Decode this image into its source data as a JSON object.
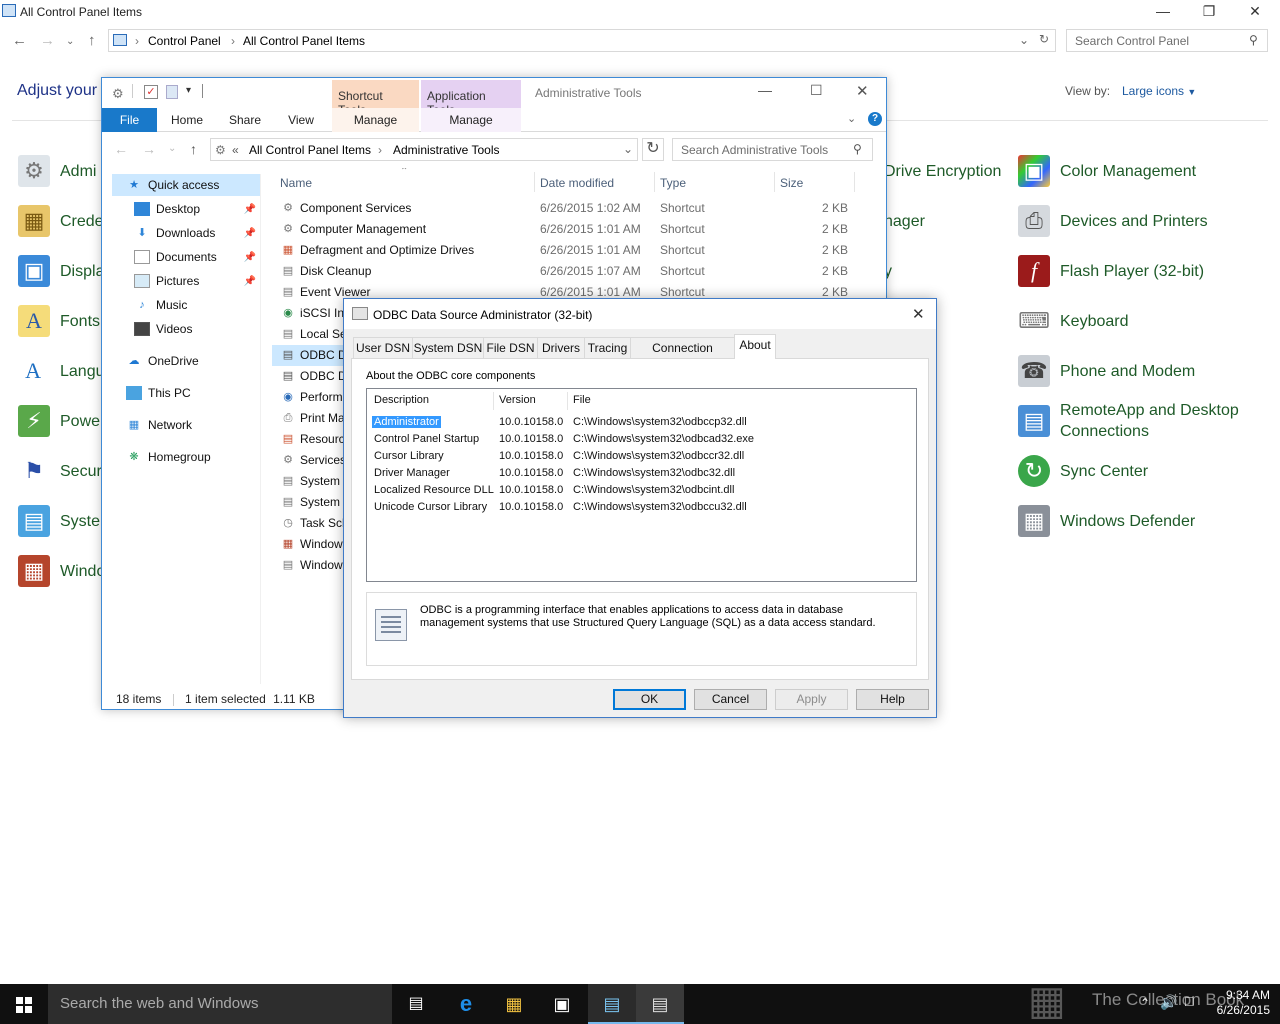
{
  "control_panel": {
    "window_title": "All Control Panel Items",
    "breadcrumb": [
      "Control Panel",
      "All Control Panel Items"
    ],
    "search_placeholder": "Search Control Panel",
    "heading": "Adjust your",
    "view_by_label": "View by:",
    "view_by_value": "Large icons",
    "left_items": [
      "Admi",
      "Crede",
      "Displa",
      "Fonts",
      "Langu",
      "Power",
      "Secur",
      "Syster",
      "Windo"
    ],
    "middle_items": [
      "Drive Encryption",
      "nager",
      "y"
    ],
    "right_items": [
      "Color Management",
      "Devices and Printers",
      "Flash Player (32-bit)",
      "Keyboard",
      "Phone and Modem",
      "RemoteApp and Desktop Connections",
      "Sync Center",
      "Windows Defender"
    ]
  },
  "explorer": {
    "title": "Administrative Tools",
    "context_tabs": {
      "shortcut_tools": "Shortcut Tools",
      "application_tools": "Application Tools"
    },
    "ribbon_tabs": [
      "File",
      "Home",
      "Share",
      "View",
      "Manage",
      "Manage"
    ],
    "breadcrumb_prefix": "«",
    "breadcrumb": [
      "All Control Panel Items",
      "Administrative Tools"
    ],
    "search_placeholder": "Search Administrative Tools",
    "nav_pane": [
      "Quick access",
      "Desktop",
      "Downloads",
      "Documents",
      "Pictures",
      "Music",
      "Videos",
      "OneDrive",
      "This PC",
      "Network",
      "Homegroup"
    ],
    "columns": [
      "Name",
      "Date modified",
      "Type",
      "Size"
    ],
    "files": [
      {
        "name": "Component Services",
        "date": "6/26/2015 1:02 AM",
        "type": "Shortcut",
        "size": "2 KB"
      },
      {
        "name": "Computer Management",
        "date": "6/26/2015 1:01 AM",
        "type": "Shortcut",
        "size": "2 KB"
      },
      {
        "name": "Defragment and Optimize Drives",
        "date": "6/26/2015 1:01 AM",
        "type": "Shortcut",
        "size": "2 KB"
      },
      {
        "name": "Disk Cleanup",
        "date": "6/26/2015 1:07 AM",
        "type": "Shortcut",
        "size": "2 KB"
      },
      {
        "name": "Event Viewer",
        "date": "6/26/2015 1:01 AM",
        "type": "Shortcut",
        "size": "2 KB"
      },
      {
        "name": "iSCSI Ini",
        "date": "",
        "type": "",
        "size": ""
      },
      {
        "name": "Local Se",
        "date": "",
        "type": "",
        "size": ""
      },
      {
        "name": "ODBC D",
        "date": "",
        "type": "",
        "size": ""
      },
      {
        "name": "ODBC D",
        "date": "",
        "type": "",
        "size": ""
      },
      {
        "name": "Perform",
        "date": "",
        "type": "",
        "size": ""
      },
      {
        "name": "Print Ma",
        "date": "",
        "type": "",
        "size": ""
      },
      {
        "name": "Resourc",
        "date": "",
        "type": "",
        "size": ""
      },
      {
        "name": "Services",
        "date": "",
        "type": "",
        "size": ""
      },
      {
        "name": "System C",
        "date": "",
        "type": "",
        "size": ""
      },
      {
        "name": "System I",
        "date": "",
        "type": "",
        "size": ""
      },
      {
        "name": "Task Sch",
        "date": "",
        "type": "",
        "size": ""
      },
      {
        "name": "Window",
        "date": "",
        "type": "",
        "size": ""
      },
      {
        "name": "Window",
        "date": "",
        "type": "",
        "size": ""
      }
    ],
    "status": {
      "items": "18 items",
      "selected": "1 item selected",
      "size": "1.11 KB"
    }
  },
  "odbc": {
    "title": "ODBC Data Source Administrator (32-bit)",
    "tabs": [
      "User DSN",
      "System DSN",
      "File DSN",
      "Drivers",
      "Tracing",
      "Connection Pooling",
      "About"
    ],
    "active_tab": "About",
    "section_label": "About the ODBC core components",
    "list_headers": [
      "Description",
      "Version",
      "File"
    ],
    "components": [
      {
        "description": "Administrator",
        "version": "10.0.10158.0",
        "file": "C:\\Windows\\system32\\odbccp32.dll"
      },
      {
        "description": "Control Panel Startup",
        "version": "10.0.10158.0",
        "file": "C:\\Windows\\system32\\odbcad32.exe"
      },
      {
        "description": "Cursor Library",
        "version": "10.0.10158.0",
        "file": "C:\\Windows\\system32\\odbccr32.dll"
      },
      {
        "description": "Driver Manager",
        "version": "10.0.10158.0",
        "file": "C:\\Windows\\system32\\odbc32.dll"
      },
      {
        "description": "Localized Resource DLL",
        "version": "10.0.10158.0",
        "file": "C:\\Windows\\system32\\odbcint.dll"
      },
      {
        "description": "Unicode Cursor Library",
        "version": "10.0.10158.0",
        "file": "C:\\Windows\\system32\\odbccu32.dll"
      }
    ],
    "info_text": "ODBC is a programming interface that enables applications to access data in database management systems that use Structured Query Language (SQL) as a data access standard.",
    "buttons": {
      "ok": "OK",
      "cancel": "Cancel",
      "apply": "Apply",
      "help": "Help"
    }
  },
  "taskbar": {
    "search_placeholder": "Search the web and Windows",
    "time": "9:34 AM",
    "date": "6/26/2015",
    "watermark": "The Collection Book"
  },
  "colors": {
    "accent": "#0078d7",
    "link": "#1e5a28",
    "heading": "#1e3287",
    "selection": "#3399ff"
  }
}
